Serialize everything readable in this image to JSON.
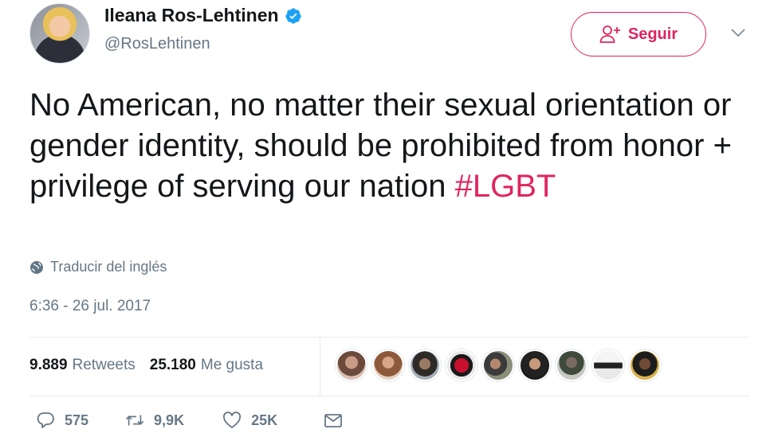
{
  "author": {
    "name": "Ileana Ros-Lehtinen",
    "handle": "@RosLehtinen"
  },
  "follow_label": "Seguir",
  "tweet": {
    "text_main": "No American, no matter their sexual orientation or gender identity, should be prohibited from honor + privilege of serving our nation ",
    "hashtag": "#LGBT"
  },
  "translate_label": "Traducir del inglés",
  "timestamp": "6:36 - 26 jul. 2017",
  "stats": {
    "retweets_count": "9.889",
    "retweets_label": "Retweets",
    "likes_count": "25.180",
    "likes_label": "Me gusta"
  },
  "actions": {
    "replies": "575",
    "retweets": "9,9K",
    "likes": "25K"
  },
  "colors": {
    "accent": "#e0245e",
    "verified": "#1da1f2",
    "muted": "#657786",
    "text": "#14171a"
  },
  "icons": {
    "verified": "verified-badge-icon",
    "follow": "add-user-icon",
    "menu": "chevron-down-icon",
    "translate": "globe-icon",
    "reply": "reply-icon",
    "retweet": "retweet-icon",
    "like": "heart-icon",
    "message": "envelope-icon"
  }
}
